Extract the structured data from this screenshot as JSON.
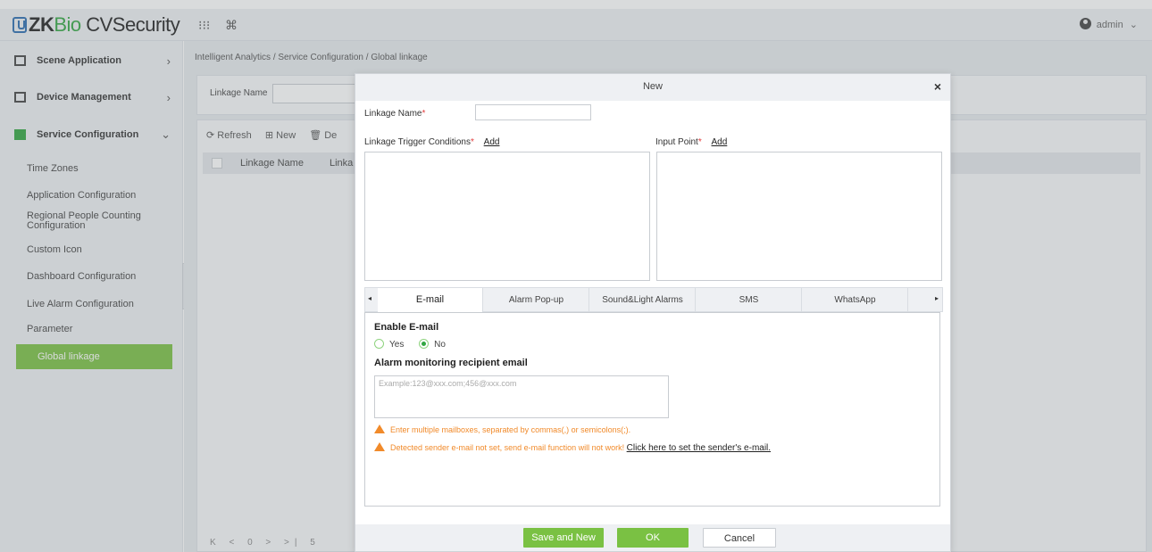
{
  "app": {
    "logo_prefix": "ZK",
    "logo_bio": "Bio",
    "logo_suffix": " CVSecurity",
    "user": "admin",
    "user_chevron": "⌄",
    "grid_icon": "⁝⁝⁝",
    "cmd_icon": "⌘"
  },
  "sidebar": {
    "scene_application": "Scene Application",
    "device_management": "Device Management",
    "service_configuration": "Service Configuration",
    "arrow_right": "›",
    "arrow_down": "⌄",
    "items": [
      {
        "label": "Time Zones"
      },
      {
        "label": "Application Configuration"
      },
      {
        "label": "Regional People Counting Configuration"
      },
      {
        "label": "Custom Icon"
      },
      {
        "label": "Dashboard Configuration"
      },
      {
        "label": "Live Alarm Configuration"
      },
      {
        "label": "Parameter"
      },
      {
        "label": "Global linkage"
      }
    ],
    "collapse_glyph": "◂"
  },
  "main": {
    "breadcrumb": "Intelligent Analytics / Service Configuration / Global linkage",
    "filter_label": "Linkage Name",
    "toolbar": {
      "refresh": "⟳ Refresh",
      "new": "⊞ New",
      "delete": "🗑 De"
    },
    "table_headers": [
      "Linkage Name",
      "Linka"
    ],
    "pager": "K < 0 > >| 5"
  },
  "dialog": {
    "title": "New",
    "close": "×",
    "linkage_name_label": "Linkage Name",
    "trigger_label": "Linkage Trigger Conditions",
    "input_point_label": "Input Point",
    "required_mark": "*",
    "add_link": "Add",
    "tab_prev": "◂",
    "tab_next": "▸",
    "tabs": [
      {
        "label": "E-mail"
      },
      {
        "label": "Alarm Pop-up"
      },
      {
        "label": "Sound&Light Alarms"
      },
      {
        "label": "SMS"
      },
      {
        "label": "WhatsApp"
      }
    ],
    "email": {
      "enable_title": "Enable E-mail",
      "yes": "Yes",
      "no": "No",
      "selected": "No",
      "recipient_title": "Alarm monitoring recipient email",
      "placeholder": "Example:123@xxx.com;456@xxx.com",
      "warn_multiple": "Enter multiple mailboxes, separated by commas(,) or semicolons(;).",
      "warn_sender": "Detected sender e-mail not set, send e-mail function will not work!",
      "sender_link": "Click here to set the sender's e-mail."
    },
    "buttons": {
      "save_new": "Save and New",
      "ok": "OK",
      "cancel": "Cancel"
    }
  },
  "colors": {
    "accent_green": "#7ac143",
    "brand_blue": "#2b6cb0",
    "warning_orange": "#f18a2a",
    "required_red": "#e23c3c"
  }
}
